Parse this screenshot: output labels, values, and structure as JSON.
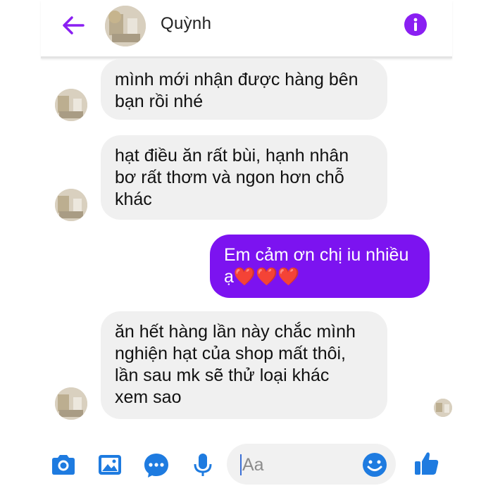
{
  "header": {
    "title": "Quỳnh",
    "back_icon": "arrow-left-icon",
    "info_icon": "info-icon"
  },
  "colors": {
    "accent": "#7c13f0",
    "incoming_bubble": "#f0f0f0",
    "heart": "#ff2a2a",
    "toolbar_icon": "#1e7be0"
  },
  "messages": [
    {
      "direction": "in",
      "text": "mình mới nhận được hàng bên\nbạn rồi nhé"
    },
    {
      "direction": "in",
      "text": "hạt điều ăn rất bùi, hạnh nhân\nbơ rất thơm và ngon hơn chỗ\nkhác"
    },
    {
      "direction": "out",
      "text": "Em cảm ơn chị iu nhiều\nạ",
      "emoji": "❤️❤️❤️"
    },
    {
      "direction": "in",
      "text": "ăn hết hàng lần này chắc mình\nnghiện hạt của shop mất thôi,\nlần sau mk sẽ thử loại khác\nxem sao"
    }
  ],
  "composer": {
    "placeholder": "Aa",
    "icons": [
      "camera-icon",
      "image-icon",
      "chat-bubble-icon",
      "microphone-icon",
      "emoji-icon",
      "thumbs-up-icon"
    ]
  }
}
